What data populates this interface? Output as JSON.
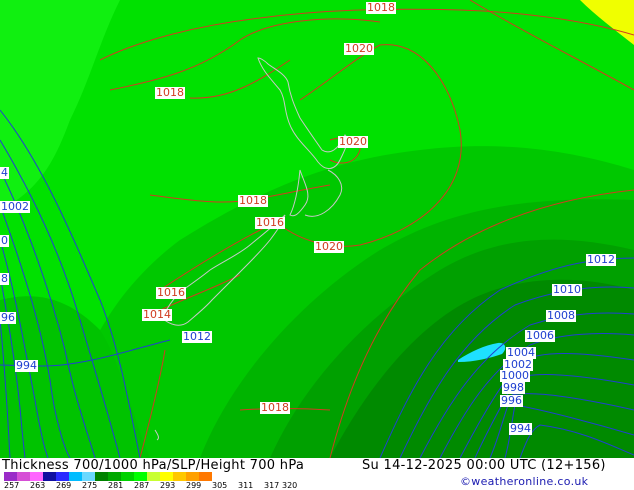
{
  "footer": {
    "title": "Thickness 700/1000 hPa/SLP/Height 700 hPa",
    "valid_time": "Su 14-12-2025 00:00 UTC (12+156)",
    "copyright": "©weatheronline.co.uk"
  },
  "colorbar": {
    "ticks": [
      "257",
      "263",
      "269",
      "275",
      "281",
      "287",
      "293",
      "299",
      "305",
      "311",
      "317",
      "320"
    ],
    "colors": [
      "#9a2cc8",
      "#d64fd6",
      "#ff66ff",
      "#1010a0",
      "#2a2aff",
      "#00bcff",
      "#6ad8ff",
      "#008200",
      "#00a800",
      "#00d200",
      "#00ff00",
      "#c8ff32",
      "#ffff00",
      "#ffc800",
      "#ffa000",
      "#ff7800"
    ]
  },
  "map": {
    "slp_labels": [
      "1018",
      "1020",
      "1018",
      "1020",
      "1018",
      "1016",
      "1020",
      "1016",
      "1014",
      "1012",
      "1012",
      "1010",
      "1008",
      "1006",
      "1004",
      "1002",
      "1000",
      "998",
      "996",
      "994",
      "1018",
      "994",
      "1002",
      "0",
      "8",
      "96",
      "4"
    ]
  }
}
